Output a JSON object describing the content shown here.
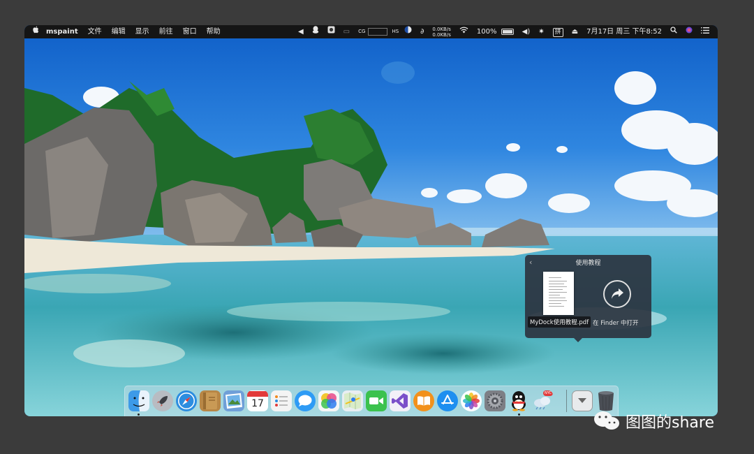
{
  "menubar": {
    "apple_icon": "apple-icon",
    "app_name": "mspaint",
    "menus": [
      "文件",
      "编辑",
      "显示",
      "前往",
      "窗口",
      "帮助"
    ],
    "status": {
      "network_up": "0.0KB/s",
      "network_down": "0.0KB/s",
      "battery": "100%",
      "ime": "拼",
      "clock": "7月17日 周三 下午8:52"
    }
  },
  "popover": {
    "title": "使用教程",
    "file_name": "MyDock使用教程.pdf",
    "open_label": "在 Finder 中打开"
  },
  "dock": {
    "apps": [
      {
        "name": "finder",
        "icon": "finder-icon",
        "color": "#3d9ae8",
        "running": true
      },
      {
        "name": "launchpad",
        "icon": "rocket-icon",
        "color": "#b8bcc2",
        "running": false
      },
      {
        "name": "safari",
        "icon": "compass-icon",
        "color": "#2c8de0",
        "running": false
      },
      {
        "name": "notes-book",
        "icon": "book-icon",
        "color": "#b88746",
        "running": false
      },
      {
        "name": "preview",
        "icon": "photo-icon",
        "color": "#6f9fd8",
        "running": false
      },
      {
        "name": "calendar",
        "icon": "calendar-icon",
        "color": "#ffffff",
        "running": false
      },
      {
        "name": "reminders",
        "icon": "list-icon",
        "color": "#f4f4f4",
        "running": false
      },
      {
        "name": "messages",
        "icon": "chat-icon",
        "color": "#2e9bf5",
        "running": false
      },
      {
        "name": "color-app",
        "icon": "colorwheel-icon",
        "color": "#e84a8a",
        "running": false
      },
      {
        "name": "maps",
        "icon": "map-icon",
        "color": "#7cc06a",
        "running": false
      },
      {
        "name": "facetime",
        "icon": "video-icon",
        "color": "#3bc24d",
        "running": false
      },
      {
        "name": "visual-studio",
        "icon": "vs-icon",
        "color": "#7b4fc9",
        "running": false
      },
      {
        "name": "ibooks",
        "icon": "open-book-icon",
        "color": "#f2911b",
        "running": false
      },
      {
        "name": "app-store",
        "icon": "appstore-icon",
        "color": "#1e8ff0",
        "running": false
      },
      {
        "name": "photos",
        "icon": "flower-icon",
        "color": "#ffffff",
        "running": false
      },
      {
        "name": "system-preferences",
        "icon": "gear-icon",
        "color": "#7d7f85",
        "running": false
      },
      {
        "name": "qq",
        "icon": "penguin-icon",
        "color": "#1a1a1a",
        "running": true
      },
      {
        "name": "weather",
        "icon": "cloud-icon",
        "color": "#d8e6f2",
        "running": false
      },
      {
        "name": "downloads",
        "icon": "download-stack-icon",
        "color": "#e8eaec",
        "running": false
      },
      {
        "name": "trash",
        "icon": "trash-icon",
        "color": "#5a5f66",
        "running": false
      }
    ],
    "calendar_day": "17",
    "weather_badge": "NYC"
  },
  "watermark": {
    "logo": "wechat-icon",
    "text": "图图的share"
  }
}
